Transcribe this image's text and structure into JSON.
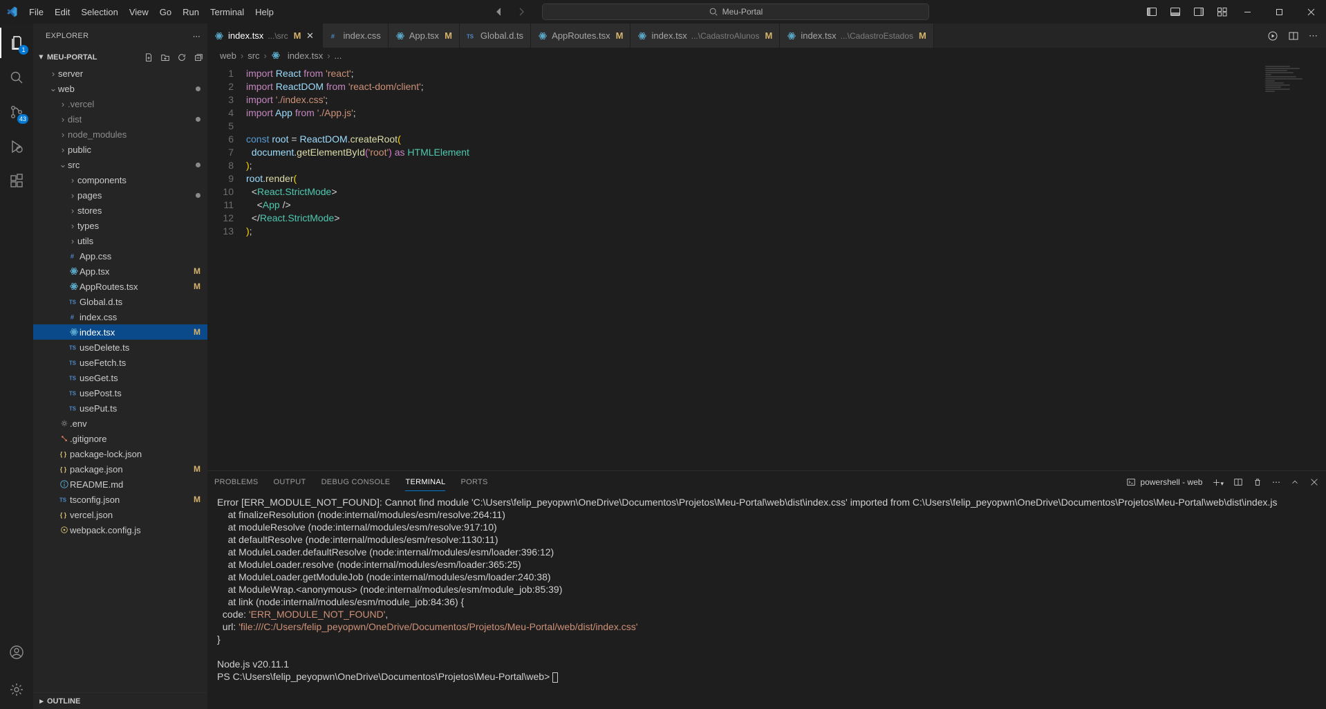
{
  "title_bar": {
    "menu": [
      "File",
      "Edit",
      "Selection",
      "View",
      "Go",
      "Run",
      "Terminal",
      "Help"
    ],
    "command_center": "Meu-Portal"
  },
  "activity": {
    "explorer_badge": "1",
    "scm_badge": "43"
  },
  "sidebar": {
    "title": "EXPLORER",
    "project": "MEU-PORTAL",
    "outline": "OUTLINE",
    "tree": [
      {
        "d": 1,
        "t": "folder",
        "c": false,
        "label": "server"
      },
      {
        "d": 1,
        "t": "folder",
        "c": true,
        "label": "web",
        "dot": true
      },
      {
        "d": 2,
        "t": "folder",
        "c": false,
        "label": ".vercel",
        "muted": true
      },
      {
        "d": 2,
        "t": "folder",
        "c": false,
        "label": "dist",
        "muted": true,
        "dot": true
      },
      {
        "d": 2,
        "t": "folder",
        "c": false,
        "label": "node_modules",
        "muted": true
      },
      {
        "d": 2,
        "t": "folder",
        "c": false,
        "label": "public"
      },
      {
        "d": 2,
        "t": "folder",
        "c": true,
        "label": "src",
        "dot": true
      },
      {
        "d": 3,
        "t": "folder",
        "c": false,
        "label": "components"
      },
      {
        "d": 3,
        "t": "folder",
        "c": false,
        "label": "pages",
        "dot": true
      },
      {
        "d": 3,
        "t": "folder",
        "c": false,
        "label": "stores"
      },
      {
        "d": 3,
        "t": "folder",
        "c": false,
        "label": "types"
      },
      {
        "d": 3,
        "t": "folder",
        "c": false,
        "label": "utils"
      },
      {
        "d": 3,
        "t": "file",
        "icon": "css",
        "label": "App.css"
      },
      {
        "d": 3,
        "t": "file",
        "icon": "react",
        "label": "App.tsx",
        "m": true
      },
      {
        "d": 3,
        "t": "file",
        "icon": "react",
        "label": "AppRoutes.tsx",
        "m": true
      },
      {
        "d": 3,
        "t": "file",
        "icon": "ts",
        "label": "Global.d.ts"
      },
      {
        "d": 3,
        "t": "file",
        "icon": "css",
        "label": "index.css"
      },
      {
        "d": 3,
        "t": "file",
        "icon": "react",
        "label": "index.tsx",
        "m": true,
        "sel": true
      },
      {
        "d": 3,
        "t": "file",
        "icon": "ts",
        "label": "useDelete.ts"
      },
      {
        "d": 3,
        "t": "file",
        "icon": "ts",
        "label": "useFetch.ts"
      },
      {
        "d": 3,
        "t": "file",
        "icon": "ts",
        "label": "useGet.ts"
      },
      {
        "d": 3,
        "t": "file",
        "icon": "ts",
        "label": "usePost.ts"
      },
      {
        "d": 3,
        "t": "file",
        "icon": "ts",
        "label": "usePut.ts"
      },
      {
        "d": 2,
        "t": "file",
        "icon": "gear",
        "label": ".env"
      },
      {
        "d": 2,
        "t": "file",
        "icon": "git",
        "label": ".gitignore"
      },
      {
        "d": 2,
        "t": "file",
        "icon": "json",
        "label": "package-lock.json"
      },
      {
        "d": 2,
        "t": "file",
        "icon": "json",
        "label": "package.json",
        "m": true
      },
      {
        "d": 2,
        "t": "file",
        "icon": "info",
        "label": "README.md"
      },
      {
        "d": 2,
        "t": "file",
        "icon": "tsconf",
        "label": "tsconfig.json",
        "m": true
      },
      {
        "d": 2,
        "t": "file",
        "icon": "json",
        "label": "vercel.json"
      },
      {
        "d": 2,
        "t": "file",
        "icon": "js",
        "label": "webpack.config.js"
      }
    ]
  },
  "tabs": [
    {
      "icon": "react",
      "label": "index.tsx",
      "sub": "...\\src",
      "m": true,
      "active": true,
      "close": true
    },
    {
      "icon": "css",
      "label": "index.css"
    },
    {
      "icon": "react",
      "label": "App.tsx",
      "m": true
    },
    {
      "icon": "ts",
      "label": "Global.d.ts"
    },
    {
      "icon": "react",
      "label": "AppRoutes.tsx",
      "m": true
    },
    {
      "icon": "react",
      "label": "index.tsx",
      "sub": "...\\CadastroAlunos",
      "m": true
    },
    {
      "icon": "react",
      "label": "index.tsx",
      "sub": "...\\CadastroEstados",
      "m": true
    }
  ],
  "breadcrumb": {
    "parts": [
      "web",
      "src",
      "index.tsx",
      "..."
    ]
  },
  "code": {
    "lines": [
      {
        "n": 1,
        "html": "<span class='s-kw'>import</span> <span class='s-var'>React</span> <span class='s-kw'>from</span> <span class='s-str'>'react'</span><span class='s-pun'>;</span>"
      },
      {
        "n": 2,
        "html": "<span class='s-kw'>import</span> <span class='s-var'>ReactDOM</span> <span class='s-kw'>from</span> <span class='s-str'>'react-dom/client'</span><span class='s-pun'>;</span>"
      },
      {
        "n": 3,
        "html": "<span class='s-kw'>import</span> <span class='s-str'>'./index.css'</span><span class='s-pun'>;</span>"
      },
      {
        "n": 4,
        "html": "<span class='s-kw'>import</span> <span class='s-var'>App</span> <span class='s-kw'>from</span> <span class='s-str'>'./App.js'</span><span class='s-pun'>;</span>"
      },
      {
        "n": 5,
        "html": ""
      },
      {
        "n": 6,
        "html": "<span class='s-def'>const</span> <span class='s-var'>root</span> <span class='s-pun'>=</span> <span class='s-var'>ReactDOM</span><span class='s-pun'>.</span><span class='s-fn'>createRoot</span><span class='s-br'>(</span>"
      },
      {
        "n": 7,
        "html": "  <span class='s-var'>document</span><span class='s-pun'>.</span><span class='s-fn'>getElementById</span><span class='s-br2'>(</span><span class='s-str'>'root'</span><span class='s-br2'>)</span> <span class='s-kw'>as</span> <span class='s-type'>HTMLElement</span>"
      },
      {
        "n": 8,
        "html": "<span class='s-br'>)</span><span class='s-pun'>;</span>"
      },
      {
        "n": 9,
        "html": "<span class='s-var'>root</span><span class='s-pun'>.</span><span class='s-fn'>render</span><span class='s-br'>(</span>"
      },
      {
        "n": 10,
        "html": "  <span class='s-pun'>&lt;</span><span class='s-tag'>React.StrictMode</span><span class='s-pun'>&gt;</span>"
      },
      {
        "n": 11,
        "html": "    <span class='s-pun'>&lt;</span><span class='s-tag'>App</span> <span class='s-pun'>/&gt;</span>"
      },
      {
        "n": 12,
        "html": "  <span class='s-pun'>&lt;/</span><span class='s-tag'>React.StrictMode</span><span class='s-pun'>&gt;</span>"
      },
      {
        "n": 13,
        "html": "<span class='s-br'>)</span><span class='s-pun'>;</span>"
      }
    ]
  },
  "panel": {
    "tabs": [
      "PROBLEMS",
      "OUTPUT",
      "DEBUG CONSOLE",
      "TERMINAL",
      "PORTS"
    ],
    "active": 3,
    "shell": "powershell - web",
    "lines": [
      "",
      "Error [ERR_MODULE_NOT_FOUND]: Cannot find module 'C:\\Users\\felip_peyopwn\\OneDrive\\Documentos\\Projetos\\Meu-Portal\\web\\dist\\index.css' imported from C:\\Users\\felip_peyopwn\\OneDrive\\Documentos\\Projetos\\Meu-Portal\\web\\dist\\index.js",
      "    at finalizeResolution (node:internal/modules/esm/resolve:264:11)",
      "    at moduleResolve (node:internal/modules/esm/resolve:917:10)",
      "    at defaultResolve (node:internal/modules/esm/resolve:1130:11)",
      "    at ModuleLoader.defaultResolve (node:internal/modules/esm/loader:396:12)",
      "    at ModuleLoader.resolve (node:internal/modules/esm/loader:365:25)",
      "    at ModuleLoader.getModuleJob (node:internal/modules/esm/loader:240:38)",
      "    at ModuleWrap.<anonymous> (node:internal/modules/esm/module_job:85:39)",
      "    at link (node:internal/modules/esm/module_job:84:36) {"
    ],
    "code_label": "  code: ",
    "code_val": "'ERR_MODULE_NOT_FOUND'",
    "url_label": "  url: ",
    "url_val": "'file:///C:/Users/felip_peyopwn/OneDrive/Documentos/Projetos/Meu-Portal/web/dist/index.css'",
    "brace": "}",
    "nodever": "Node.js v20.11.1",
    "prompt": "PS C:\\Users\\felip_peyopwn\\OneDrive\\Documentos\\Projetos\\Meu-Portal\\web> "
  }
}
